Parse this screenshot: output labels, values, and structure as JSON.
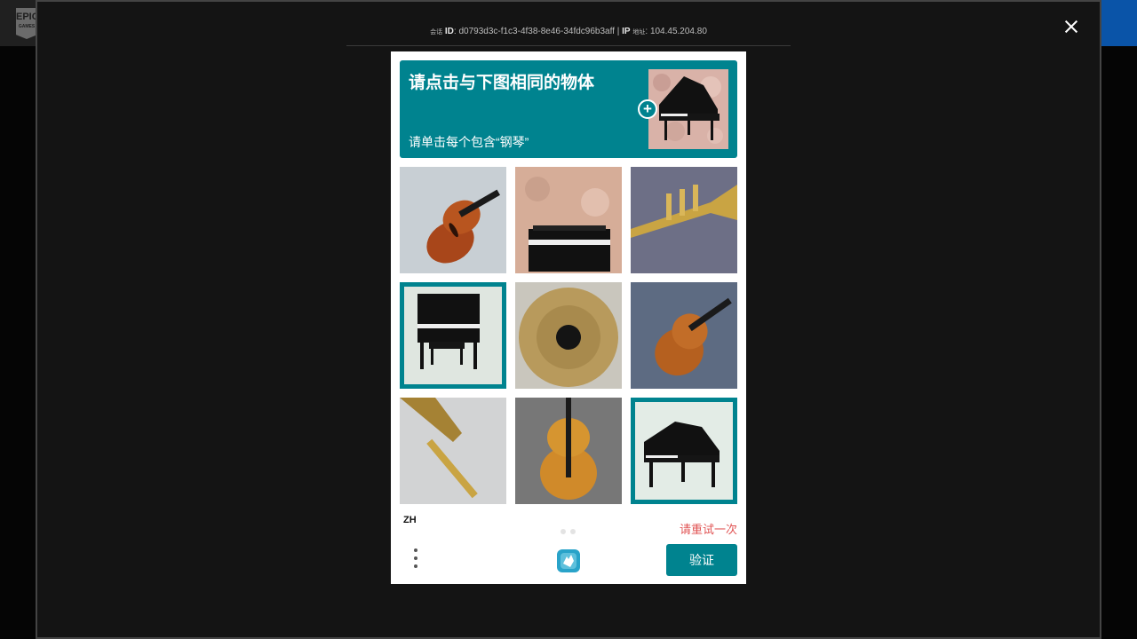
{
  "site": {
    "logo_line1": "EPIC",
    "logo_line2": "GAMES"
  },
  "session": {
    "session_label": "会话",
    "id_label": "ID",
    "session_id": "d0793d3c-f1c3-4f38-8e46-34fdc96b3aff",
    "separator": "|",
    "ip_label": "IP",
    "ip_suffix": "地址",
    "ip_value": "104.45.204.80"
  },
  "captcha": {
    "prompt_title": "请点击与下图相同的物体",
    "prompt_subtitle": "请单击每个包含“钢琴”",
    "example_subject": "grand piano",
    "add_badge": "+",
    "tiles": [
      {
        "subject": "violin",
        "selected": false
      },
      {
        "subject": "upright piano",
        "selected": false
      },
      {
        "subject": "trumpet",
        "selected": false
      },
      {
        "subject": "upright piano with bench",
        "selected": true
      },
      {
        "subject": "cymbal",
        "selected": false
      },
      {
        "subject": "violin",
        "selected": false
      },
      {
        "subject": "trombone",
        "selected": false
      },
      {
        "subject": "violin",
        "selected": false
      },
      {
        "subject": "grand piano",
        "selected": true
      }
    ],
    "language": "ZH",
    "error_text": "请重试一次",
    "submit_label": "验证",
    "accent_color": "#00838f",
    "error_color": "#e05353"
  }
}
